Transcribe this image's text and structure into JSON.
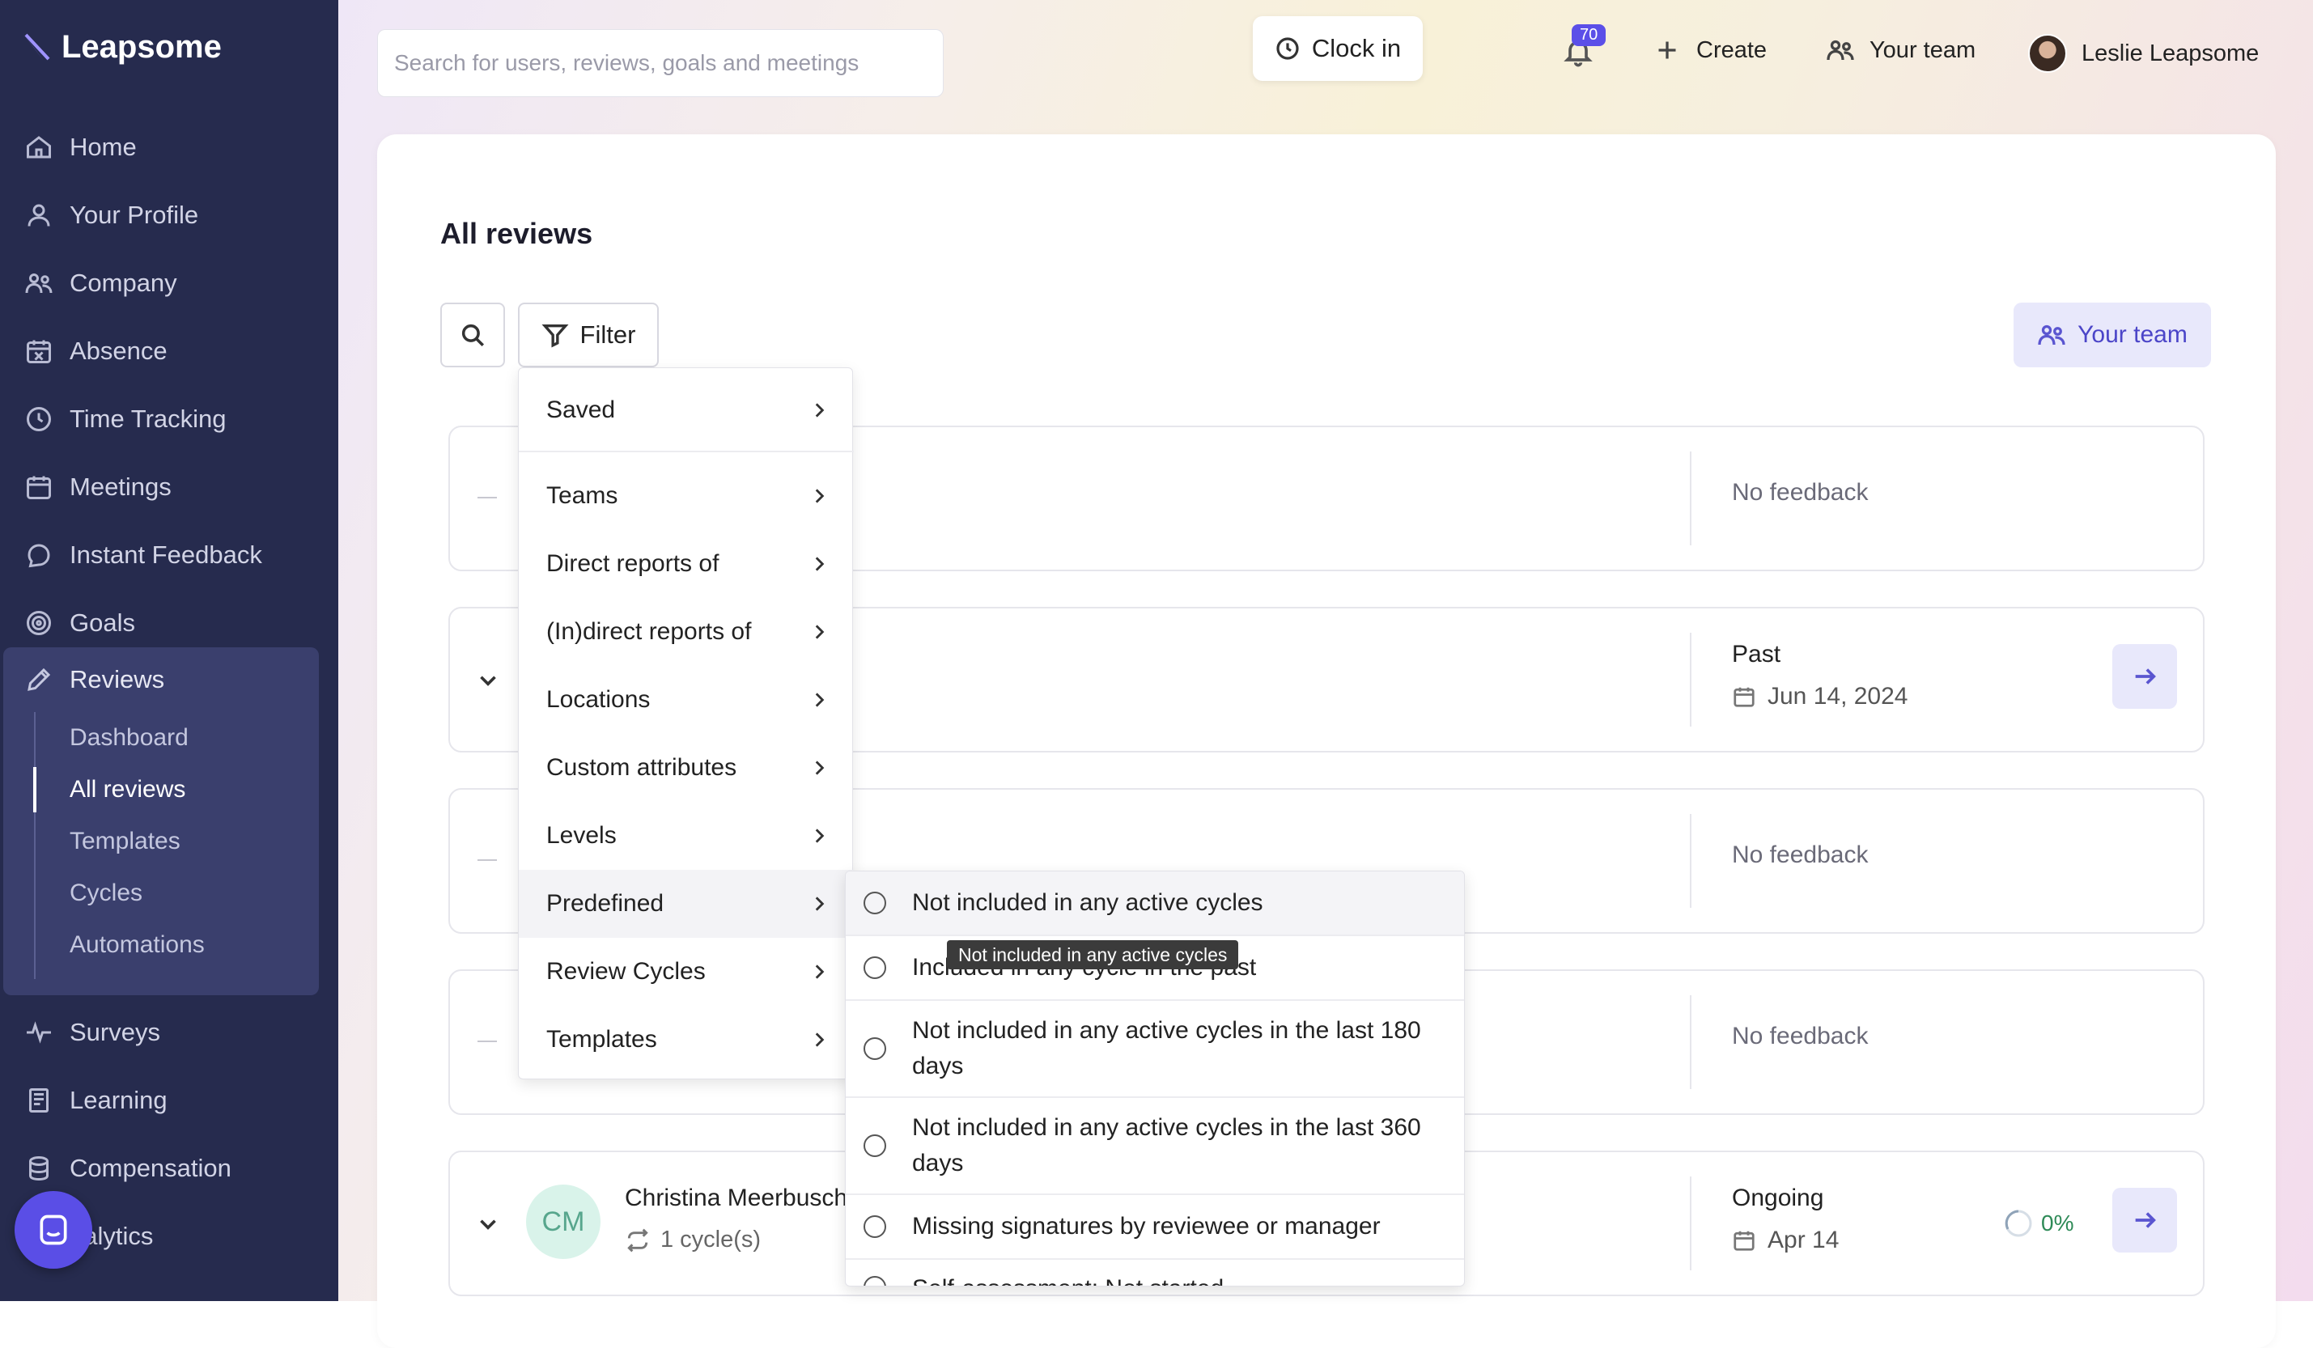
{
  "brand": {
    "name": "Leapsome",
    "color": "#262b4e",
    "accent": "#5b4fe8"
  },
  "sidebar": {
    "items": [
      {
        "label": "Home",
        "icon": "home-icon"
      },
      {
        "label": "Your Profile",
        "icon": "user-icon"
      },
      {
        "label": "Company",
        "icon": "people-icon"
      },
      {
        "label": "Absence",
        "icon": "calendar-x-icon"
      },
      {
        "label": "Time Tracking",
        "icon": "clock-icon"
      },
      {
        "label": "Meetings",
        "icon": "calendar-icon"
      },
      {
        "label": "Instant Feedback",
        "icon": "chat-icon"
      },
      {
        "label": "Goals",
        "icon": "target-icon"
      }
    ],
    "reviews": {
      "label": "Reviews",
      "sub": [
        "Dashboard",
        "All reviews",
        "Templates",
        "Cycles",
        "Automations"
      ],
      "active": "All reviews"
    },
    "lower": [
      {
        "label": "Surveys",
        "icon": "pulse-icon"
      },
      {
        "label": "Learning",
        "icon": "book-icon"
      },
      {
        "label": "Compensation",
        "icon": "coins-icon"
      },
      {
        "label": "nalytics",
        "icon": "chart-icon"
      }
    ]
  },
  "topbar": {
    "search_placeholder": "Search for users, reviews, goals and meetings",
    "clock_in": "Clock in",
    "notifications": "70",
    "create": "Create",
    "your_team": "Your team",
    "user_name": "Leslie Leapsome"
  },
  "page": {
    "title": "All reviews",
    "filter_label": "Filter",
    "your_team_button": "Your team"
  },
  "rows": [
    {
      "feedback": "No feedback"
    },
    {
      "status": "Past",
      "date": "Jun 14, 2024"
    },
    {
      "feedback": "No feedback"
    },
    {
      "feedback": "No feedback"
    },
    {
      "initials": "CM",
      "name": "Christina Meerbusch",
      "cycles": "1 cycle(s)",
      "status": "Ongoing",
      "date": "Apr 14",
      "progress": "0%"
    }
  ],
  "filter_menu": {
    "items": [
      "Saved",
      "Teams",
      "Direct reports of",
      "(In)direct reports of",
      "Locations",
      "Custom attributes",
      "Levels",
      "Predefined",
      "Review Cycles",
      "Templates"
    ],
    "highlighted": "Predefined"
  },
  "predefined_menu": {
    "options": [
      "Not included in any active cycles",
      "Included in any cycle in the past",
      "Not included in any active cycles in the last 180 days",
      "Not included in any active cycles in the last 360 days",
      "Missing signatures by reviewee or manager",
      "Self-assessment: Not started"
    ],
    "tooltip": "Not included in any active cycles"
  }
}
